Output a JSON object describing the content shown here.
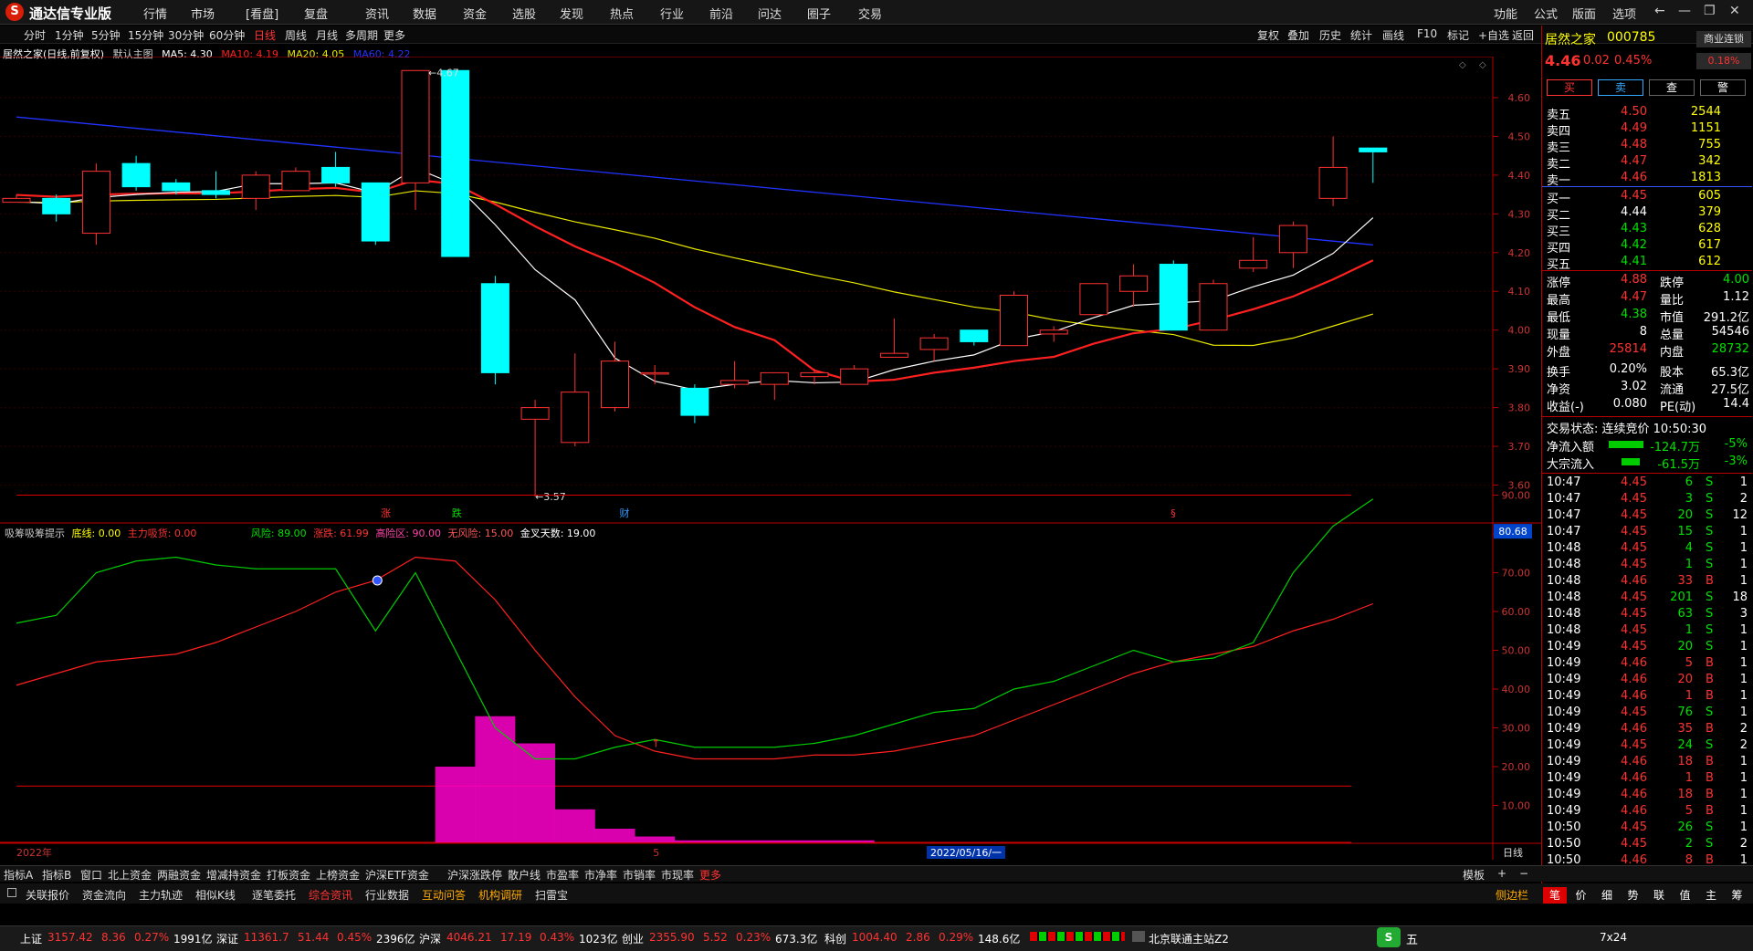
{
  "app": {
    "title": "通达信专业版",
    "logo": "logo-icon"
  },
  "menu": [
    "行情",
    "市场",
    "[看盘]",
    "复盘",
    "资讯",
    "数据",
    "资金",
    "选股",
    "发现",
    "热点",
    "行业",
    "前沿",
    "问达",
    "圈子",
    "交易"
  ],
  "menu_right": [
    "功能",
    "公式",
    "版面",
    "选项"
  ],
  "periods": [
    "分时",
    "1分钟",
    "5分钟",
    "15分钟",
    "30分钟",
    "60分钟",
    "日线",
    "周线",
    "月线",
    "多周期",
    "更多"
  ],
  "active_period": "日线",
  "toolbar": [
    "复权",
    "叠加",
    "历史",
    "统计",
    "画线",
    "F10",
    "标记",
    "+自选",
    "返回"
  ],
  "main_chart": {
    "stock_label": "居然之家(日线,前复权)",
    "template_label": "默认主图",
    "ma5": "MA5: 4.30",
    "ma10": "MA10: 4.19",
    "ma20": "MA20: 4.05",
    "ma60": "MA60: 4.22",
    "hi_label": "4.67",
    "lo_label": "3.57",
    "axis": [
      "4.60",
      "4.50",
      "4.40",
      "4.30",
      "4.20",
      "4.10",
      "4.00",
      "3.90",
      "3.80",
      "3.70",
      "3.60"
    ],
    "markers": [
      "涨",
      "跌",
      "财",
      "§"
    ]
  },
  "candles": [
    {
      "o": 4.33,
      "c": 4.34,
      "h": 4.35,
      "l": 4.33
    },
    {
      "o": 4.34,
      "c": 4.3,
      "h": 4.35,
      "l": 4.28
    },
    {
      "o": 4.25,
      "c": 4.41,
      "h": 4.43,
      "l": 4.22
    },
    {
      "o": 4.43,
      "c": 4.37,
      "h": 4.45,
      "l": 4.36
    },
    {
      "o": 4.38,
      "c": 4.36,
      "h": 4.39,
      "l": 4.35
    },
    {
      "o": 4.36,
      "c": 4.35,
      "h": 4.41,
      "l": 4.34
    },
    {
      "o": 4.34,
      "c": 4.4,
      "h": 4.41,
      "l": 4.31
    },
    {
      "o": 4.36,
      "c": 4.41,
      "h": 4.42,
      "l": 4.36
    },
    {
      "o": 4.42,
      "c": 4.38,
      "h": 4.46,
      "l": 4.37
    },
    {
      "o": 4.38,
      "c": 4.23,
      "h": 4.38,
      "l": 4.22
    },
    {
      "o": 4.38,
      "c": 4.67,
      "h": 4.67,
      "l": 4.31
    },
    {
      "o": 4.67,
      "c": 4.19,
      "h": 4.67,
      "l": 4.19
    },
    {
      "o": 4.12,
      "c": 3.89,
      "h": 4.14,
      "l": 3.86
    },
    {
      "o": 3.77,
      "c": 3.8,
      "h": 3.82,
      "l": 3.57
    },
    {
      "o": 3.71,
      "c": 3.84,
      "h": 3.94,
      "l": 3.7
    },
    {
      "o": 3.8,
      "c": 3.92,
      "h": 3.97,
      "l": 3.79
    },
    {
      "o": 3.89,
      "c": 3.89,
      "h": 3.91,
      "l": 3.86
    },
    {
      "o": 3.85,
      "c": 3.78,
      "h": 3.86,
      "l": 3.76
    },
    {
      "o": 3.86,
      "c": 3.87,
      "h": 3.92,
      "l": 3.85
    },
    {
      "o": 3.86,
      "c": 3.89,
      "h": 3.89,
      "l": 3.82
    },
    {
      "o": 3.88,
      "c": 3.89,
      "h": 3.9,
      "l": 3.86
    },
    {
      "o": 3.86,
      "c": 3.9,
      "h": 3.91,
      "l": 3.86
    },
    {
      "o": 3.93,
      "c": 3.94,
      "h": 4.03,
      "l": 3.93
    },
    {
      "o": 3.95,
      "c": 3.98,
      "h": 3.99,
      "l": 3.92
    },
    {
      "o": 4.0,
      "c": 3.97,
      "h": 4.0,
      "l": 3.96
    },
    {
      "o": 3.96,
      "c": 4.09,
      "h": 4.1,
      "l": 3.96
    },
    {
      "o": 3.99,
      "c": 4.0,
      "h": 4.01,
      "l": 3.97
    },
    {
      "o": 4.04,
      "c": 4.12,
      "h": 4.12,
      "l": 4.04
    },
    {
      "o": 4.1,
      "c": 4.14,
      "h": 4.17,
      "l": 4.06
    },
    {
      "o": 4.17,
      "c": 4.0,
      "h": 4.18,
      "l": 4.0
    },
    {
      "o": 4.0,
      "c": 4.12,
      "h": 4.13,
      "l": 4.0
    },
    {
      "o": 4.16,
      "c": 4.18,
      "h": 4.24,
      "l": 4.15
    },
    {
      "o": 4.2,
      "c": 4.27,
      "h": 4.28,
      "l": 4.16
    },
    {
      "o": 4.34,
      "c": 4.42,
      "h": 4.5,
      "l": 4.32
    },
    {
      "o": 4.47,
      "c": 4.46,
      "h": 4.47,
      "l": 4.38
    }
  ],
  "indicator": {
    "name": "吸筹吸筹提示",
    "base": "底线: 0.00",
    "main_buy": "主力吸货: 0.00",
    "risk": "风险: 89.00",
    "rise": "涨跌: 61.99",
    "high_risk": "高险区: 90.00",
    "no_risk": "无风险: 15.00",
    "golden": "金叉天数: 19.00",
    "axis": [
      "90.00",
      "80.00",
      "70.00",
      "60.00",
      "50.00",
      "40.00",
      "30.00",
      "20.00",
      "10.00"
    ],
    "current_tag": "80.68",
    "green_line": [
      57,
      59,
      70,
      73,
      74,
      72,
      71,
      71,
      71,
      55,
      70,
      50,
      30,
      22,
      22,
      25,
      27,
      25,
      25,
      25,
      26,
      28,
      31,
      34,
      35,
      40,
      42,
      46,
      50,
      47,
      48,
      52,
      70,
      82,
      89
    ],
    "red_line": [
      41,
      44,
      47,
      48,
      49,
      52,
      56,
      60,
      65,
      68,
      74,
      73,
      63,
      50,
      38,
      28,
      24,
      22,
      22,
      22,
      23,
      23,
      24,
      26,
      28,
      32,
      36,
      40,
      44,
      47,
      49,
      51,
      55,
      58,
      62
    ],
    "bars": [
      0,
      0,
      0,
      0,
      0,
      0,
      0,
      0,
      0,
      0,
      0,
      20,
      33,
      26,
      9,
      4,
      2,
      1,
      1,
      1,
      1,
      1,
      0,
      0,
      0,
      0,
      0,
      0,
      0,
      0,
      0,
      0,
      0,
      0,
      0
    ],
    "date_label": "2022/05/16/一",
    "year_label": "2022年",
    "month_label": "5",
    "x_right": "日线"
  },
  "quote": {
    "name": "居然之家",
    "code": "000785",
    "price": "4.46",
    "change": "0.02",
    "pct": "0.45%",
    "badge": "商业连锁",
    "badge_pct": "0.18%",
    "buttons": [
      "买",
      "卖",
      "查",
      "警"
    ],
    "asks": [
      {
        "l": "卖五",
        "p": "4.50",
        "v": "2544"
      },
      {
        "l": "卖四",
        "p": "4.49",
        "v": "1151"
      },
      {
        "l": "卖三",
        "p": "4.48",
        "v": "755"
      },
      {
        "l": "卖二",
        "p": "4.47",
        "v": "342"
      },
      {
        "l": "卖一",
        "p": "4.46",
        "v": "1813"
      }
    ],
    "bids": [
      {
        "l": "买一",
        "p": "4.45",
        "v": "605"
      },
      {
        "l": "买二",
        "p": "4.44",
        "v": "379"
      },
      {
        "l": "买三",
        "p": "4.43",
        "v": "628"
      },
      {
        "l": "买四",
        "p": "4.42",
        "v": "617"
      },
      {
        "l": "买五",
        "p": "4.41",
        "v": "612"
      }
    ],
    "stats": [
      [
        "涨停",
        "4.88",
        "跌停",
        "4.00"
      ],
      [
        "最高",
        "4.47",
        "量比",
        "1.12"
      ],
      [
        "最低",
        "4.38",
        "市值",
        "291.2亿"
      ],
      [
        "现量",
        "8",
        "总量",
        "54546"
      ],
      [
        "外盘",
        "25814",
        "内盘",
        "28732"
      ],
      [
        "换手",
        "0.20%",
        "股本",
        "65.3亿"
      ],
      [
        "净资",
        "3.02",
        "流通",
        "27.5亿"
      ],
      [
        "收益(-)",
        "0.080",
        "PE(动)",
        "14.4"
      ]
    ],
    "trade_status": "交易状态: 连续竞价 10:50:30",
    "flow": [
      {
        "l": "净流入额",
        "v": "-124.7万",
        "p": "-5%"
      },
      {
        "l": "大宗流入",
        "v": "-61.5万",
        "p": "-3%"
      }
    ],
    "ticks": [
      [
        "10:47",
        "4.45",
        "6",
        "S",
        "1"
      ],
      [
        "10:47",
        "4.45",
        "3",
        "S",
        "2"
      ],
      [
        "10:47",
        "4.45",
        "20",
        "S",
        "12"
      ],
      [
        "10:47",
        "4.45",
        "15",
        "S",
        "1"
      ],
      [
        "10:48",
        "4.45",
        "4",
        "S",
        "1"
      ],
      [
        "10:48",
        "4.45",
        "1",
        "S",
        "1"
      ],
      [
        "10:48",
        "4.46",
        "33",
        "B",
        "1"
      ],
      [
        "10:48",
        "4.45",
        "201",
        "S",
        "18"
      ],
      [
        "10:48",
        "4.45",
        "63",
        "S",
        "3"
      ],
      [
        "10:48",
        "4.45",
        "1",
        "S",
        "1"
      ],
      [
        "10:49",
        "4.45",
        "20",
        "S",
        "1"
      ],
      [
        "10:49",
        "4.46",
        "5",
        "B",
        "1"
      ],
      [
        "10:49",
        "4.46",
        "20",
        "B",
        "1"
      ],
      [
        "10:49",
        "4.46",
        "1",
        "B",
        "1"
      ],
      [
        "10:49",
        "4.45",
        "76",
        "S",
        "1"
      ],
      [
        "10:49",
        "4.46",
        "35",
        "B",
        "2"
      ],
      [
        "10:49",
        "4.45",
        "24",
        "S",
        "2"
      ],
      [
        "10:49",
        "4.46",
        "18",
        "B",
        "1"
      ],
      [
        "10:49",
        "4.46",
        "1",
        "B",
        "1"
      ],
      [
        "10:49",
        "4.46",
        "18",
        "B",
        "1"
      ],
      [
        "10:49",
        "4.46",
        "5",
        "B",
        "1"
      ],
      [
        "10:50",
        "4.45",
        "26",
        "S",
        "1"
      ],
      [
        "10:50",
        "4.45",
        "2",
        "S",
        "2"
      ],
      [
        "10:50",
        "4.46",
        "8",
        "B",
        "1"
      ]
    ],
    "side_tabs": [
      "笔",
      "价",
      "细",
      "势",
      "联",
      "值",
      "主",
      "筹"
    ]
  },
  "bottom_tabs": [
    "指标A",
    "指标B",
    "窗口",
    "北上资金",
    "两融资金",
    "增减持资金",
    "打板资金",
    "上榜资金",
    "沪深ETF资金",
    "沪深涨跌停",
    "散户线",
    "市盈率",
    "市净率",
    "市销率",
    "市现率",
    "更多"
  ],
  "bottom_tabs_right": [
    "模板",
    "+",
    "−"
  ],
  "tools": [
    "关联报价",
    "资金流向",
    "主力轨迹",
    "相似K线",
    "逐笔委托",
    "综合资讯",
    "行业数据",
    "互动问答",
    "机构调研",
    "扫雷宝"
  ],
  "tools_right": "侧边栏",
  "status": [
    {
      "n": "上证",
      "p": "3157.42",
      "c": "8.36",
      "pc": "0.27%",
      "a": "1991亿"
    },
    {
      "n": "深证",
      "p": "11361.7",
      "c": "51.44",
      "pc": "0.45%",
      "a": "2396亿"
    },
    {
      "n": "沪深",
      "p": "4046.21",
      "c": "17.19",
      "pc": "0.43%",
      "a": "1023亿"
    },
    {
      "n": "创业",
      "p": "2355.90",
      "c": "5.52",
      "pc": "0.23%",
      "a": "673.3亿"
    },
    {
      "n": "科创",
      "p": "1004.40",
      "c": "2.86",
      "pc": "0.29%",
      "a": "148.6亿"
    }
  ],
  "server": "北京联通主站Z2",
  "ime": "五",
  "clock": "7x24",
  "colors": {
    "up": "#ff3232",
    "down": "#00ffff",
    "ma5": "#ffffff",
    "ma10": "#ff2020",
    "ma20": "#e6e600",
    "ma60": "#2233ff",
    "green_line": "#00cc00",
    "red_line": "#ff2020",
    "bar": "#ff00cc"
  }
}
